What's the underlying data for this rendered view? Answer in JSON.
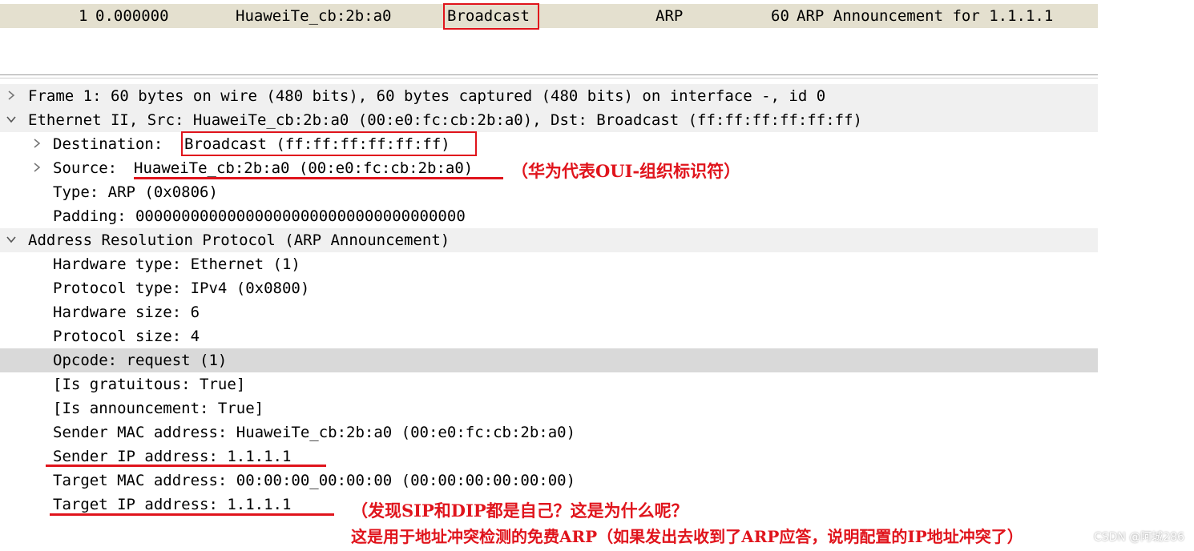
{
  "packet_row": {
    "no": "1",
    "time": "0.000000",
    "source": "HuaweiTe_cb:2b:a0",
    "destination": "Broadcast",
    "protocol": "ARP",
    "length": "60",
    "info": "ARP Announcement for 1.1.1.1"
  },
  "details": {
    "frame": "Frame 1: 60 bytes on wire (480 bits), 60 bytes captured (480 bits) on interface -, id 0",
    "ethernet": "Ethernet II, Src: HuaweiTe_cb:2b:a0 (00:e0:fc:cb:2b:a0), Dst: Broadcast (ff:ff:ff:ff:ff:ff)",
    "eth_destination_label": "Destination: ",
    "eth_destination_value": "Broadcast (ff:ff:ff:ff:ff:ff)",
    "eth_source_label": "Source: ",
    "eth_source_value": "HuaweiTe_cb:2b:a0 (00:e0:fc:cb:2b:a0)",
    "eth_type": "Type: ARP (0x0806)",
    "eth_padding": "Padding: 000000000000000000000000000000000000",
    "arp": "Address Resolution Protocol (ARP Announcement)",
    "hw_type": "Hardware type: Ethernet (1)",
    "proto_type": "Protocol type: IPv4 (0x0800)",
    "hw_size": "Hardware size: 6",
    "proto_size": "Protocol size: 4",
    "opcode": "Opcode: request (1)",
    "is_gratuitous": "[Is gratuitous: True]",
    "is_announcement": "[Is announcement: True]",
    "sender_mac": "Sender MAC address: HuaweiTe_cb:2b:a0 (00:e0:fc:cb:2b:a0)",
    "sender_ip": "Sender IP address: 1.1.1.1",
    "target_mac": "Target MAC address: 00:00:00_00:00:00 (00:00:00:00:00:00)",
    "target_ip": "Target IP address: 1.1.1.1"
  },
  "annotations": {
    "oui_note": "（华为代表OUI-组织标识符）",
    "sip_dip_question": "（发现SIP和DIP都是自己？这是为什么呢？",
    "gratuitous_explanation": "这是用于地址冲突检测的免费ARP（如果发出去收到了ARP应答，说明配置的IP地址冲突了）"
  },
  "watermark": "CSDN @阿城286",
  "colors": {
    "packet_row_bg": "#e4e0cf",
    "annotation_red": "#e0141c",
    "selected_row_bg": "#d9d9d9",
    "band_bg": "#f0f0f0"
  }
}
